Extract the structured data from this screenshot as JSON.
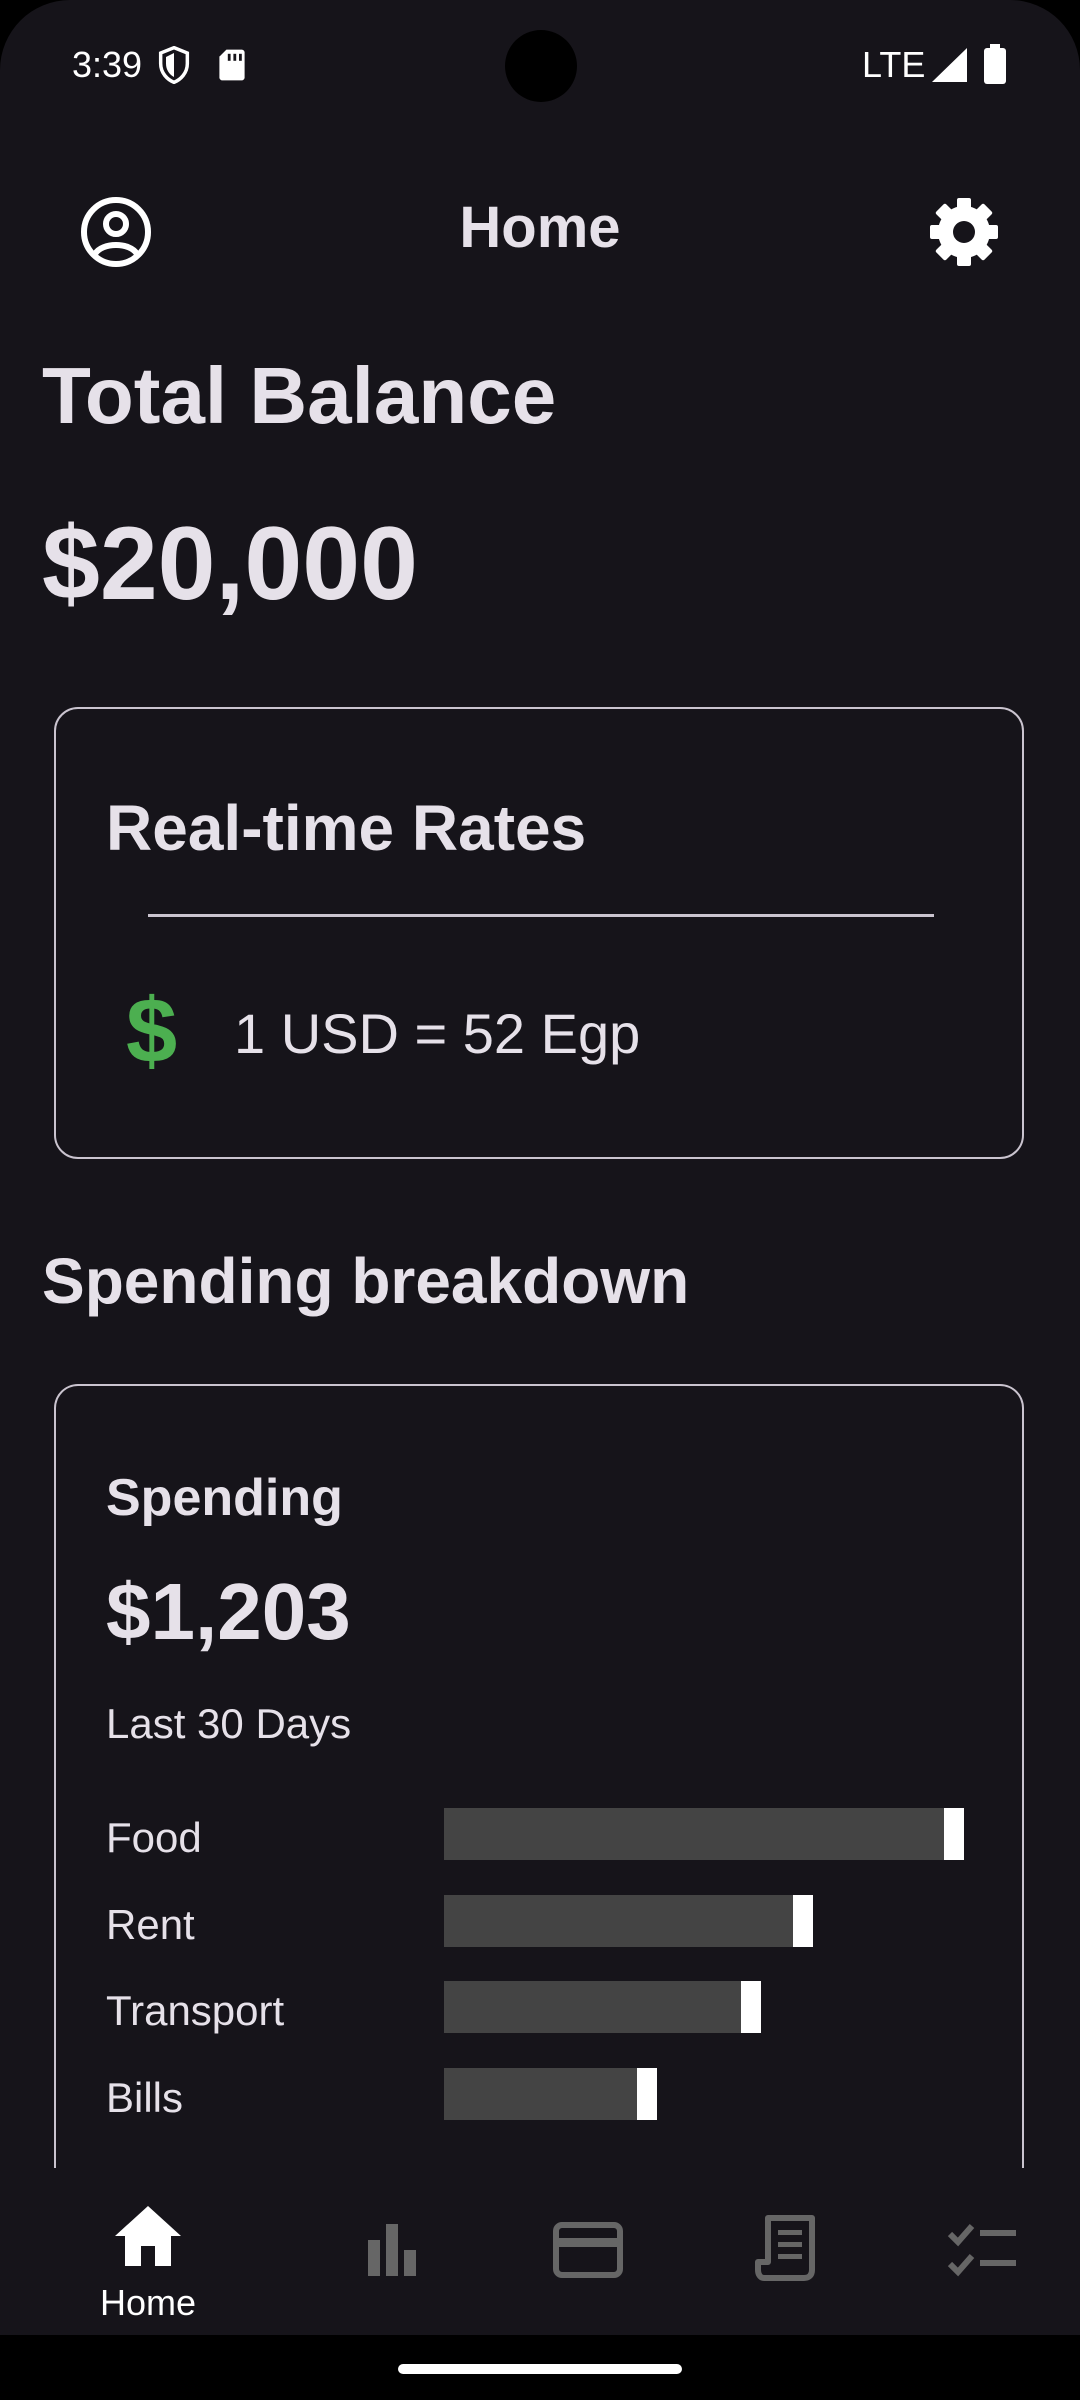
{
  "status_bar": {
    "time": "3:39",
    "network": "LTE"
  },
  "app_bar": {
    "title": "Home",
    "left_icon": "account-circle-icon",
    "right_icon": "gear-icon"
  },
  "balance": {
    "heading": "Total Balance",
    "amount": "$20,000"
  },
  "rates_card": {
    "title": "Real-time Rates",
    "currency_icon": "dollar-icon",
    "rate": "1 USD = 52 Egp",
    "accent": "#4caf50"
  },
  "spending": {
    "section_heading": "Spending breakdown",
    "card_label": "Spending",
    "total": "$1,203",
    "period": "Last 30 Days",
    "categories": [
      {
        "name": "Food",
        "fraction": 1.0
      },
      {
        "name": "Rent",
        "fraction": 0.71
      },
      {
        "name": "Transport",
        "fraction": 0.61
      },
      {
        "name": "Bills",
        "fraction": 0.41
      }
    ]
  },
  "bottom_nav": {
    "items": [
      {
        "label": "Home",
        "icon": "home-icon",
        "selected": true
      },
      {
        "label": "",
        "icon": "bar-chart-icon",
        "selected": false
      },
      {
        "label": "",
        "icon": "credit-card-icon",
        "selected": false
      },
      {
        "label": "",
        "icon": "receipt-icon",
        "selected": false
      },
      {
        "label": "",
        "icon": "checklist-icon",
        "selected": false
      }
    ]
  }
}
